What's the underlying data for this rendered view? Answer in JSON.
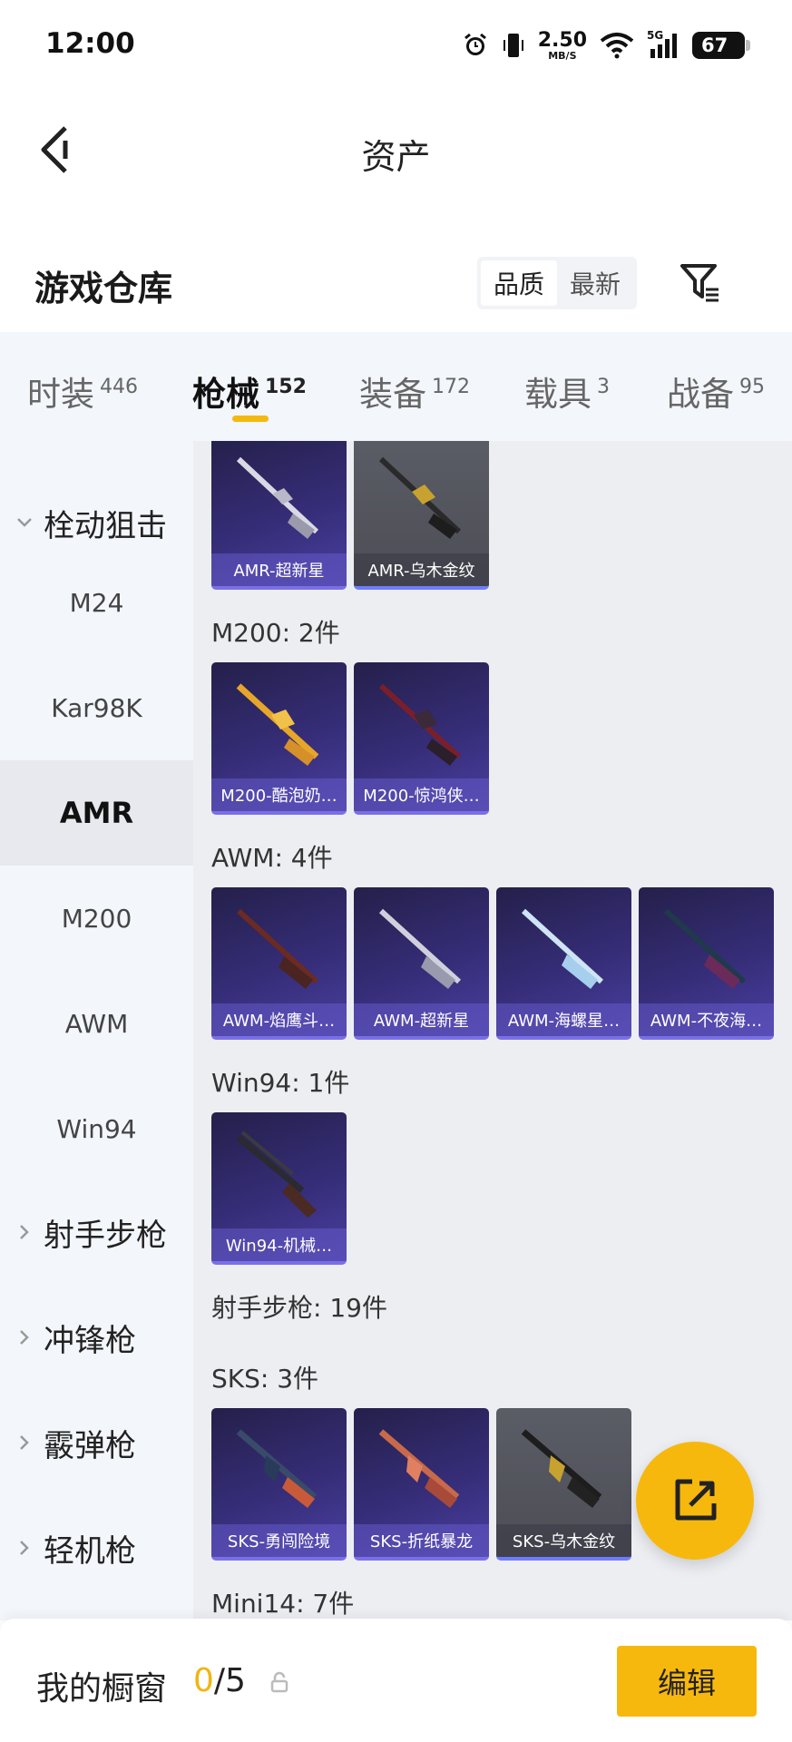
{
  "status_bar": {
    "time": "12:00",
    "net_speed": "2.50",
    "net_unit": "MB/S",
    "signal_label": "5G",
    "battery": "67"
  },
  "header": {
    "title": "资产"
  },
  "section": {
    "title": "游戏仓库",
    "sort_options": [
      "品质",
      "最新"
    ]
  },
  "tabs": [
    {
      "label": "时装",
      "count": "446"
    },
    {
      "label": "枪械",
      "count": "152"
    },
    {
      "label": "装备",
      "count": "172"
    },
    {
      "label": "载具",
      "count": "3"
    },
    {
      "label": "战备",
      "count": "95"
    }
  ],
  "sidebar": {
    "expanded_group": "栓动狙击",
    "sub_items": [
      "M24",
      "Kar98K",
      "AMR",
      "M200",
      "AWM",
      "Win94"
    ],
    "active_sub": "AMR",
    "collapsed_groups": [
      "射手步枪",
      "冲锋枪",
      "霰弹枪",
      "轻机枪"
    ]
  },
  "content": {
    "amr_items": [
      "AMR-超新星",
      "AMR-乌木金纹"
    ],
    "m200": {
      "label": "M200: 2件",
      "items": [
        "M200-酷泡奶…",
        "M200-惊鸿侠…"
      ]
    },
    "awm": {
      "label": "AWM: 4件",
      "items": [
        "AWM-焰鹰斗…",
        "AWM-超新星",
        "AWM-海螺星…",
        "AWM-不夜海…"
      ]
    },
    "win94": {
      "label": "Win94: 1件",
      "items": [
        "Win94-机械…"
      ]
    },
    "marksman_label": "射手步枪: 19件",
    "sks": {
      "label": "SKS: 3件",
      "items": [
        "SKS-勇闯险境",
        "SKS-折纸暴龙",
        "SKS-乌木金纹"
      ]
    },
    "mini14_label": "Mini14: 7件"
  },
  "bottom_bar": {
    "label": "我的橱窗",
    "current": "0",
    "total": "/5",
    "edit": "编辑"
  },
  "colors": {
    "accent": "#f7b80e",
    "card_purple": "#362d78",
    "card_gray": "#55565e"
  }
}
